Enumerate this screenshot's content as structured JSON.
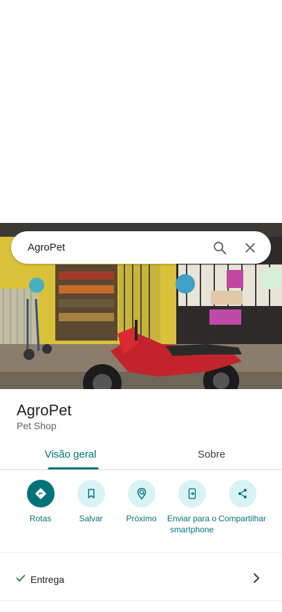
{
  "search": {
    "query": "AgroPet"
  },
  "place": {
    "name": "AgroPet",
    "category": "Pet Shop"
  },
  "tabs": [
    {
      "label": "Visão geral",
      "active": true
    },
    {
      "label": "Sobre",
      "active": false
    }
  ],
  "actions": [
    {
      "label": "Rotas",
      "icon": "directions-icon"
    },
    {
      "label": "Salvar",
      "icon": "bookmark-icon"
    },
    {
      "label": "Próximo",
      "icon": "nearby-icon"
    },
    {
      "label": "Enviar para o smartphone",
      "icon": "send-to-phone-icon"
    },
    {
      "label": "Compartilhar",
      "icon": "share-icon"
    }
  ],
  "attributes": [
    {
      "label": "Entrega",
      "icon": "check-icon"
    }
  ],
  "colors": {
    "accent": "#00737a",
    "accent_light": "#d7f3f6",
    "check": "#188038"
  }
}
